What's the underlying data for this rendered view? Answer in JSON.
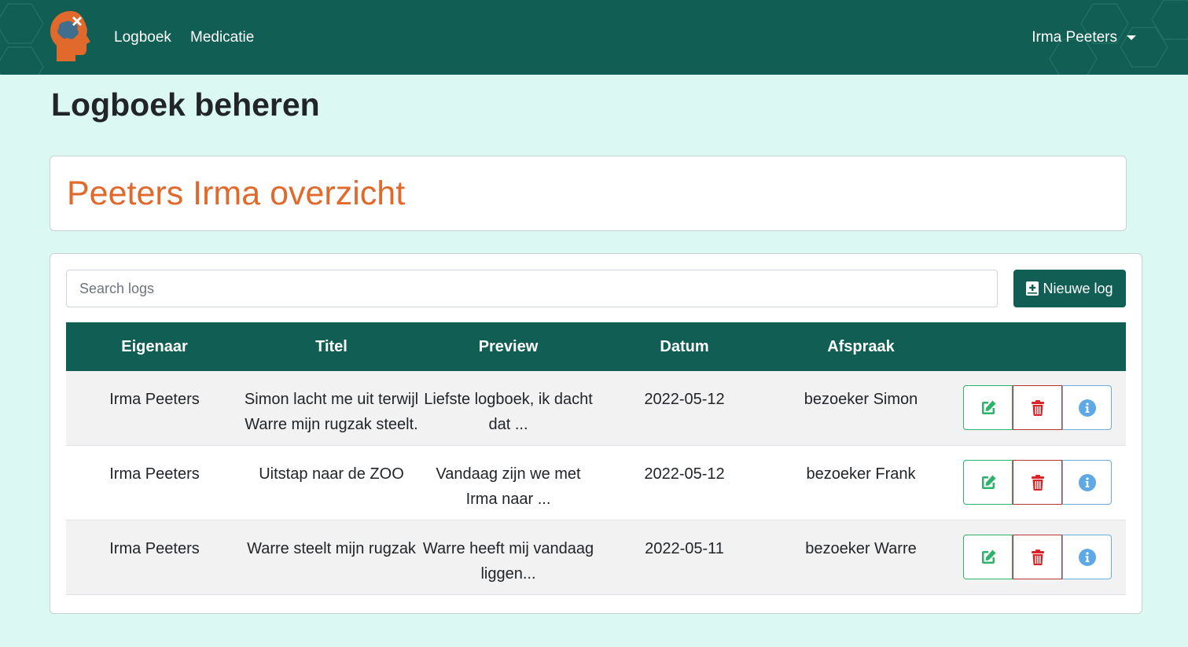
{
  "nav": {
    "links": [
      "Logboek",
      "Medicatie"
    ],
    "user": "Irma Peeters",
    "logo_icon": "head-brain-logo-icon",
    "colors": {
      "bar": "#115e54",
      "logo": "#e0692b"
    }
  },
  "page_title": "Logboek beheren",
  "overview_title": "Peeters Irma overzicht",
  "search": {
    "placeholder": "Search logs",
    "value": ""
  },
  "new_log_label": "Nieuwe log",
  "table": {
    "headers": [
      "Eigenaar",
      "Titel",
      "Preview",
      "Datum",
      "Afspraak",
      ""
    ],
    "rows": [
      {
        "owner": "Irma Peeters",
        "title": "Simon lacht me uit terwijl Warre mijn rugzak steelt.",
        "preview": "Liefste logboek, ik dacht dat ...",
        "date": "2022-05-12",
        "appointment": "bezoeker Simon"
      },
      {
        "owner": "Irma Peeters",
        "title": "Uitstap naar de ZOO",
        "preview": "Vandaag zijn we met Irma naar ...",
        "date": "2022-05-12",
        "appointment": "bezoeker Frank"
      },
      {
        "owner": "Irma Peeters",
        "title": "Warre steelt mijn rugzak",
        "preview": "Warre heeft mij vandaag liggen...",
        "date": "2022-05-11",
        "appointment": "bezoeker Warre"
      }
    ]
  },
  "action_icons": {
    "edit": "edit-icon",
    "delete": "trash-icon",
    "info": "info-icon"
  },
  "colors": {
    "edit": "#2fb36a",
    "delete": "#d9242c",
    "info": "#5fa8e6",
    "accent": "#e0692b"
  }
}
